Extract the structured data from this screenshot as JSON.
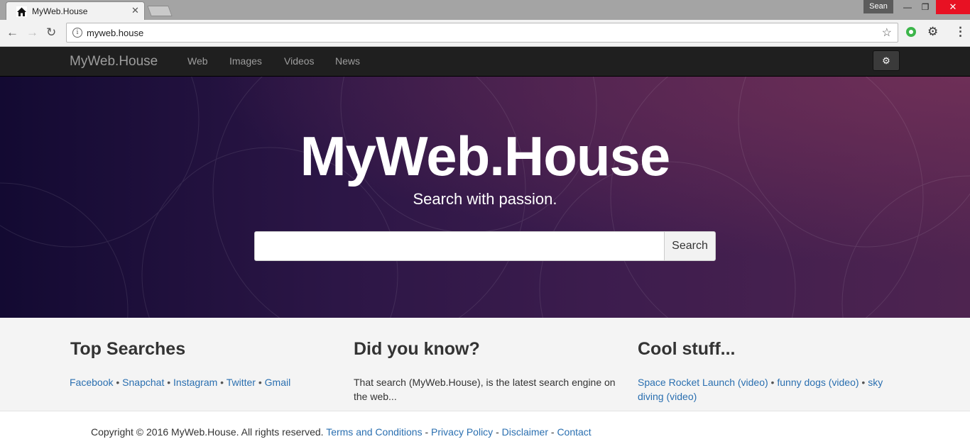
{
  "browser": {
    "tab_title": "MyWeb.House",
    "tab_close": "✕",
    "profile_name": "Sean",
    "url": "myweb.house",
    "window_controls": {
      "minimize": "—",
      "maximize": "❐",
      "close": "✕"
    }
  },
  "icons": {
    "back": "←",
    "forward": "→",
    "reload": "↻",
    "info": "i",
    "star": "☆",
    "gear": "⚙",
    "menu": "⋮"
  },
  "navbar": {
    "brand": "MyWeb.House",
    "links": [
      "Web",
      "Images",
      "Videos",
      "News"
    ],
    "settings_icon": "⚙"
  },
  "hero": {
    "title": "MyWeb.House",
    "subtitle": "Search with passion.",
    "search_value": "",
    "search_button": "Search"
  },
  "sections": {
    "top_searches": {
      "heading": "Top Searches",
      "links": [
        "Facebook",
        "Snapchat",
        "Instagram",
        "Twitter",
        "Gmail"
      ],
      "separator": " • "
    },
    "did_you_know": {
      "heading": "Did you know?",
      "text": "That search (MyWeb.House), is the latest search engine on the web..."
    },
    "cool_stuff": {
      "heading": "Cool stuff...",
      "links": [
        "Space Rocket Launch (video)",
        "funny dogs (video)",
        "sky diving (video)"
      ]
    }
  },
  "footer": {
    "copyright": "Copyright © 2016 MyWeb.House. All rights reserved.",
    "links": [
      "Terms and Conditions",
      "Privacy Policy",
      "Disclaimer",
      "Contact"
    ],
    "separator": " - "
  },
  "colors": {
    "link": "#2a6fb0",
    "navbar_bg": "#1f1f1f",
    "hero_dark": "#130a32",
    "hero_light": "#6e2f57"
  }
}
